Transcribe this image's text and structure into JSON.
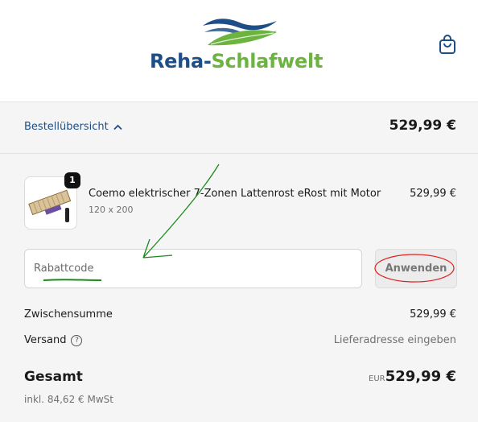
{
  "header": {
    "brand_part1": "Reha-",
    "brand_part2": "Schlafwelt",
    "cart_icon": "shopping-bag-icon"
  },
  "summary": {
    "toggle_label": "Bestellübersicht",
    "toggle_icon": "chevron-up-icon",
    "total": "529,99 €"
  },
  "line_item": {
    "quantity": "1",
    "title": "Coemo elektrischer 7-Zonen Lattenrost eRost mit Motor",
    "variant": "120 x 200",
    "price": "529,99 €"
  },
  "discount": {
    "placeholder": "Rabattcode",
    "apply_label": "Anwenden"
  },
  "totals": {
    "subtotal_label": "Zwischensumme",
    "subtotal_value": "529,99 €",
    "shipping_label": "Versand",
    "shipping_value": "Lieferadresse eingeben",
    "total_label": "Gesamt",
    "currency": "EUR",
    "total_value": "529,99 €",
    "tax_note": "inkl. 84,62 € MwSt"
  },
  "colors": {
    "brand_blue": "#1e4e86",
    "brand_green": "#6cb33f",
    "annotation_green": "#1a8a1a",
    "annotation_red": "#e02020"
  }
}
